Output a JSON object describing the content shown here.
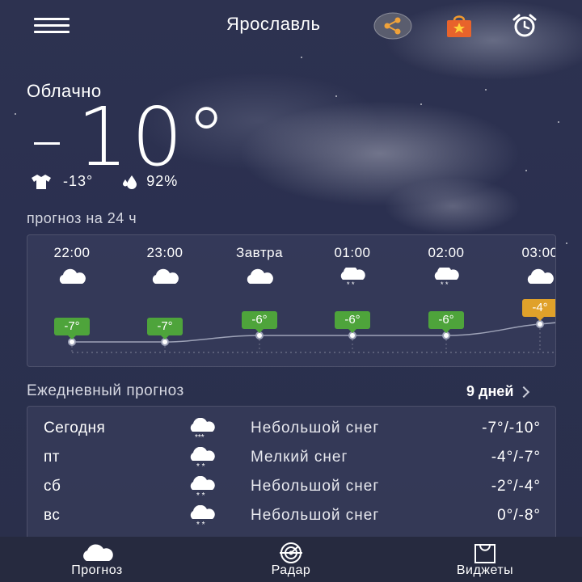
{
  "header": {
    "city": "Ярославль",
    "icons": [
      "menu-icon",
      "share-icon",
      "shop-icon",
      "alarm-icon"
    ]
  },
  "current": {
    "condition": "Облачно",
    "temperature": "10°",
    "feels_like": "-13°",
    "humidity": "92%"
  },
  "hourly": {
    "title": "прогноз на 24 ч",
    "items": [
      {
        "time": "22:00",
        "icon": "cloud-icon",
        "temp": "-7°",
        "color": "#4ea43b"
      },
      {
        "time": "23:00",
        "icon": "cloud-icon",
        "temp": "-7°",
        "color": "#4ea43b"
      },
      {
        "time": "Завтра",
        "icon": "cloud-icon",
        "temp": "-6°",
        "color": "#4ea43b"
      },
      {
        "time": "01:00",
        "icon": "snow-cloud-icon",
        "temp": "-6°",
        "color": "#4ea43b"
      },
      {
        "time": "02:00",
        "icon": "snow-cloud-icon",
        "temp": "-6°",
        "color": "#4ea43b"
      },
      {
        "time": "03:00",
        "icon": "cloud-icon",
        "temp": "-4°",
        "color": "#e0a12a"
      }
    ]
  },
  "daily": {
    "title": "Ежедневный прогноз",
    "days_link": "9 дней",
    "items": [
      {
        "day": "Сегодня",
        "icon": "snow-cloud-icon",
        "desc": "Небольшой снег",
        "temp": "-7°/-10°"
      },
      {
        "day": "пт",
        "icon": "snow-cloud-icon",
        "desc": "Мелкий снег",
        "temp": "-4°/-7°"
      },
      {
        "day": "сб",
        "icon": "snow-cloud-icon",
        "desc": "Небольшой снег",
        "temp": "-2°/-4°"
      },
      {
        "day": "вс",
        "icon": "snow-cloud-icon",
        "desc": "Небольшой снег",
        "temp": "0°/-8°"
      }
    ]
  },
  "nav": {
    "forecast": "Прогноз",
    "radar": "Радар",
    "widgets": "Виджеты"
  }
}
